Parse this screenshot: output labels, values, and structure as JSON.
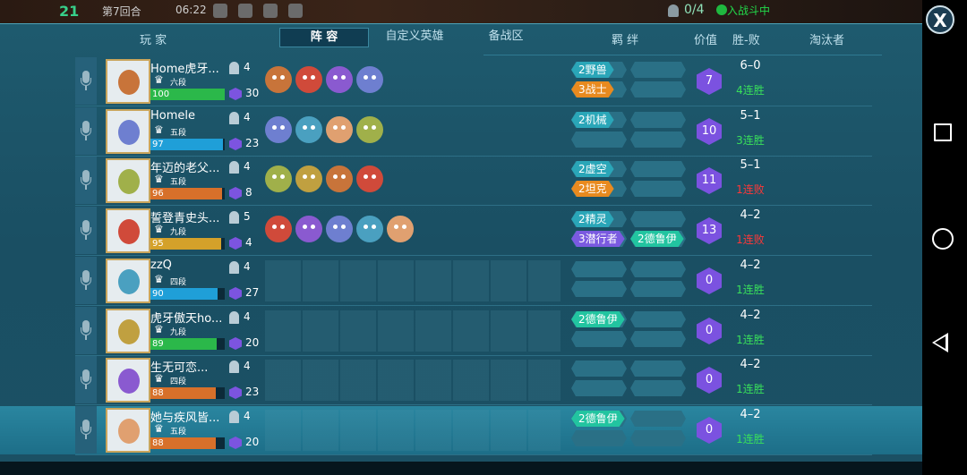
{
  "top": {
    "round_num": "21",
    "round_label": "第7回合",
    "timer": "06:22",
    "pop_count": "0/4",
    "battle_status": "入战斗中"
  },
  "close_label": "X",
  "headers": {
    "player": "玩 家",
    "bond": "羁 绊",
    "value": "价值",
    "record": "胜-败",
    "eliminator": "淘汰者"
  },
  "tabs": [
    "阵 容",
    "自定义英雄",
    "备战区"
  ],
  "colors": {
    "green_bar": "#2bb84a",
    "blue_bar": "#1f9fd8",
    "orange_bar": "#d7702a",
    "yellow_bar": "#d4a12a",
    "bond_teal": "#2aa6b8",
    "bond_orange": "#e88a1f",
    "bond_purple": "#7a5ae0",
    "bond_green": "#22c4a0",
    "value_purple": "#7b52e0",
    "win_green": "#39e05a",
    "lose_red": "#ff3838"
  },
  "players": [
    {
      "name": "Home虎牙...",
      "rank": "六段",
      "hp": "100",
      "hp_pct": 1.0,
      "hp_color": "green",
      "pop": "4",
      "gold": "30",
      "heroes": [
        "beast-hero-icon",
        "knight-hero-icon",
        "goblin-hero-icon",
        "demon-hero-icon"
      ],
      "bonds": [
        {
          "label": "2野兽",
          "color": "teal"
        },
        {
          "label": "3战士",
          "color": "orange"
        }
      ],
      "value": "7",
      "record": "6–0",
      "streak": "4连胜",
      "streak_type": "win"
    },
    {
      "name": "Homele",
      "rank": "五段",
      "hp": "97",
      "hp_pct": 0.97,
      "hp_color": "blue",
      "pop": "4",
      "gold": "23",
      "heroes": [
        "mech-hero-icon",
        "assassin-hero-icon",
        "goblin-hero-icon",
        "mage-hero-icon"
      ],
      "bonds": [
        {
          "label": "2机械",
          "color": "teal"
        }
      ],
      "value": "10",
      "record": "5–1",
      "streak": "3连胜",
      "streak_type": "win"
    },
    {
      "name": "年迈的老父...",
      "rank": "五段",
      "hp": "96",
      "hp_pct": 0.96,
      "hp_color": "orange",
      "pop": "4",
      "gold": "8",
      "heroes": [
        "pig-hero-icon",
        "goblin-hero-icon",
        "shaman-hero-icon",
        "void-hero-icon"
      ],
      "bonds": [
        {
          "label": "2虚空",
          "color": "teal"
        },
        {
          "label": "2坦克",
          "color": "orange"
        }
      ],
      "value": "11",
      "record": "5–1",
      "streak": "1连败",
      "streak_type": "lose"
    },
    {
      "name": "誓登青史头...",
      "rank": "九段",
      "hp": "95",
      "hp_pct": 0.95,
      "hp_color": "yellow",
      "pop": "5",
      "gold": "4",
      "heroes": [
        "elf-hero-icon",
        "shaman-hero-icon",
        "fox-hero-icon",
        "assassin-hero-icon",
        "druid-hero-icon"
      ],
      "bonds": [
        {
          "label": "2精灵",
          "color": "teal"
        },
        {
          "label": "3潜行者",
          "color": "purple"
        },
        {
          "label": "2德鲁伊",
          "color": "green"
        }
      ],
      "value": "13",
      "record": "4–2",
      "streak": "1连败",
      "streak_type": "lose"
    },
    {
      "name": "zzQ",
      "rank": "四段",
      "hp": "90",
      "hp_pct": 0.9,
      "hp_color": "blue",
      "pop": "4",
      "gold": "27",
      "heroes": [],
      "bonds": [],
      "value": "0",
      "record": "4–2",
      "streak": "1连胜",
      "streak_type": "win"
    },
    {
      "name": "虎牙傲天ho...",
      "rank": "九段",
      "hp": "89",
      "hp_pct": 0.89,
      "hp_color": "green",
      "pop": "4",
      "gold": "20",
      "heroes": [],
      "bonds": [
        {
          "label": "2德鲁伊",
          "color": "green"
        }
      ],
      "value": "0",
      "record": "4–2",
      "streak": "1连胜",
      "streak_type": "win"
    },
    {
      "name": "生无可恋...",
      "rank": "四段",
      "hp": "88",
      "hp_pct": 0.88,
      "hp_color": "orange",
      "pop": "4",
      "gold": "23",
      "heroes": [],
      "bonds": [],
      "value": "0",
      "record": "4–2",
      "streak": "1连胜",
      "streak_type": "win"
    },
    {
      "name": "她与疾风皆...",
      "rank": "五段",
      "hp": "88",
      "hp_pct": 0.88,
      "hp_color": "orange",
      "pop": "4",
      "gold": "20",
      "heroes": [],
      "bonds": [
        {
          "label": "2德鲁伊",
          "color": "green"
        }
      ],
      "value": "0",
      "record": "4–2",
      "streak": "1连胜",
      "streak_type": "win"
    }
  ]
}
